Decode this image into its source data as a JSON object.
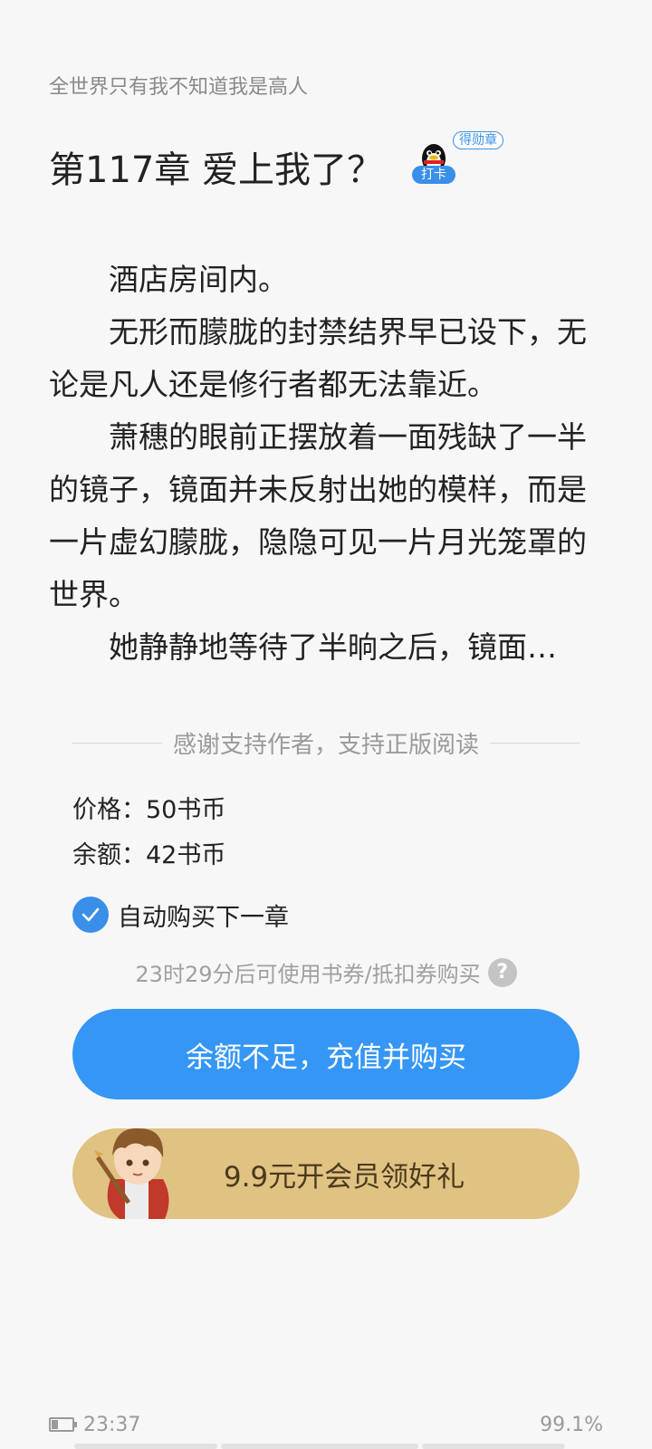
{
  "book": {
    "title": "全世界只有我不知道我是高人"
  },
  "chapter": {
    "title": "第117章 爱上我了？",
    "badge_medal": "得勋章",
    "badge_checkin": "打卡"
  },
  "content": {
    "paragraphs": [
      "酒店房间内。",
      "无形而朦胧的封禁结界早已设下，无论是凡人还是修行者都无法靠近。",
      "萧穗的眼前正摆放着一面残缺了一半的镜子，镜面并未反射出她的模样，而是一片虚幻朦胧，隐隐可见一片月光笼罩的世界。",
      "她静静地等待了半晌之后，镜面…"
    ]
  },
  "purchase": {
    "divider_text": "感谢支持作者，支持正版阅读",
    "price": "价格：50书币",
    "balance": "余额：42书币",
    "auto_buy_label": "自动购买下一章",
    "auto_buy_checked": true,
    "coupon_note": "23时29分后可使用书券/抵扣券购买",
    "buy_button": "余额不足，充值并购买",
    "vip_button": "9.9元开会员领好礼"
  },
  "status": {
    "time": "23:37",
    "progress": "99.1%",
    "battery_level": 0.2
  },
  "colors": {
    "accent": "#3596f5",
    "vip": "#e0c283",
    "background": "#f7f7f7"
  }
}
